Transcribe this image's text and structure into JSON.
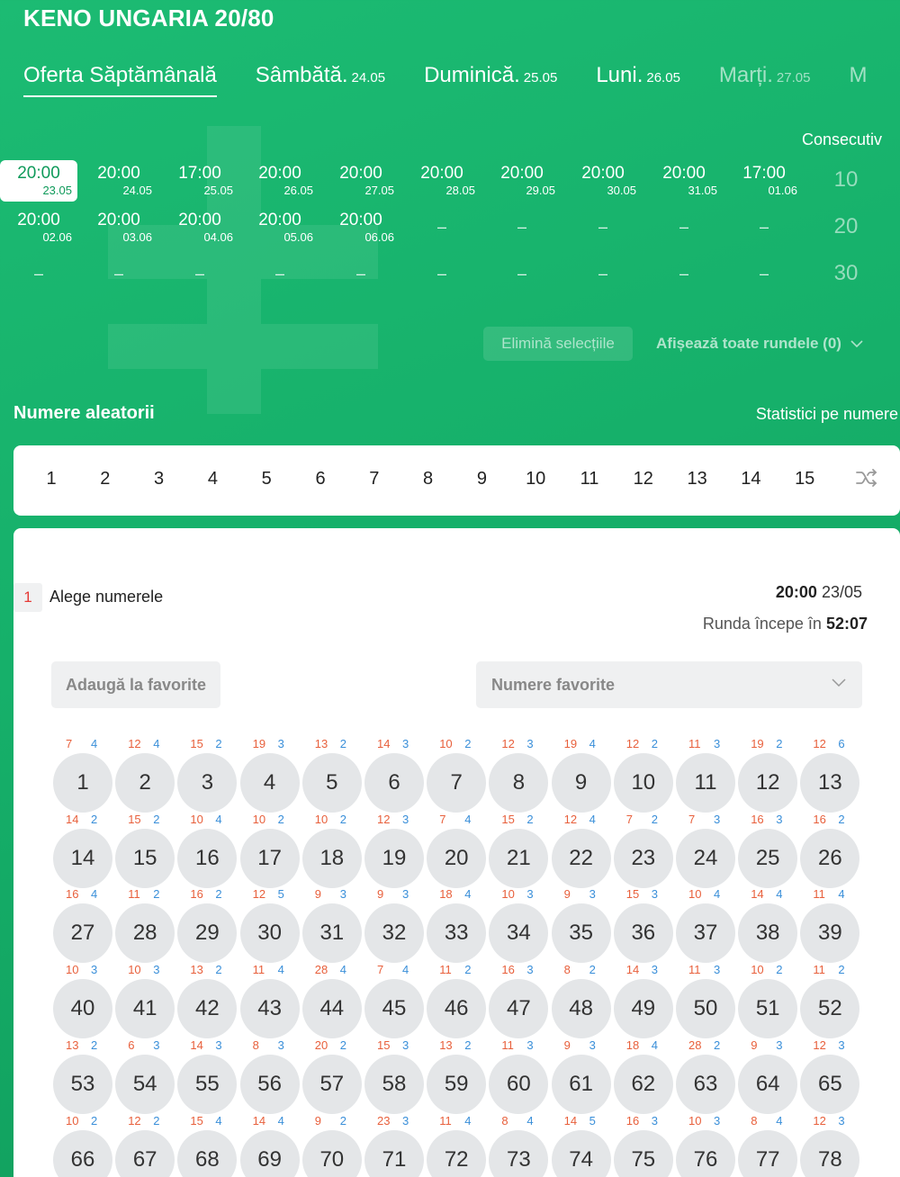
{
  "app": {
    "title": "KENO UNGARIA 20/80"
  },
  "tabs": [
    {
      "label": "Oferta Săptămânală",
      "date": ""
    },
    {
      "label": "Sâmbătă.",
      "date": "24.05"
    },
    {
      "label": "Duminică.",
      "date": "25.05"
    },
    {
      "label": "Luni.",
      "date": "26.05"
    },
    {
      "label": "Marți.",
      "date": "27.05"
    },
    {
      "label": "M",
      "date": ""
    }
  ],
  "consecutive": {
    "label": "Consecutiv",
    "values": [
      "10",
      "20",
      "30"
    ]
  },
  "slots": [
    [
      {
        "time": "20:00",
        "date": "23.05",
        "selected": true
      },
      {
        "time": "20:00",
        "date": "24.05"
      },
      {
        "time": "17:00",
        "date": "25.05"
      },
      {
        "time": "20:00",
        "date": "26.05"
      },
      {
        "time": "20:00",
        "date": "27.05"
      },
      {
        "time": "20:00",
        "date": "28.05"
      },
      {
        "time": "20:00",
        "date": "29.05"
      },
      {
        "time": "20:00",
        "date": "30.05"
      },
      {
        "time": "20:00",
        "date": "31.05"
      },
      {
        "time": "17:00",
        "date": "01.06"
      }
    ],
    [
      {
        "time": "20:00",
        "date": "02.06"
      },
      {
        "time": "20:00",
        "date": "03.06"
      },
      {
        "time": "20:00",
        "date": "04.06"
      },
      {
        "time": "20:00",
        "date": "05.06"
      },
      {
        "time": "20:00",
        "date": "06.06"
      },
      {
        "dash": "–"
      },
      {
        "dash": "–"
      },
      {
        "dash": "–"
      },
      {
        "dash": "–"
      },
      {
        "dash": "–"
      }
    ],
    [
      {
        "dash": "–"
      },
      {
        "dash": "–"
      },
      {
        "dash": "–"
      },
      {
        "dash": "–"
      },
      {
        "dash": "–"
      },
      {
        "dash": "–"
      },
      {
        "dash": "–"
      },
      {
        "dash": "–"
      },
      {
        "dash": "–"
      },
      {
        "dash": "–"
      }
    ]
  ],
  "actions": {
    "remove_selections": "Elimină selecțiile",
    "show_all_rounds": "Afișează toate rundele (0)"
  },
  "random_section": {
    "title": "Numere aleatorii",
    "stats_link": "Statistici pe numere",
    "numbers": [
      "1",
      "2",
      "3",
      "4",
      "5",
      "6",
      "7",
      "8",
      "9",
      "10",
      "11",
      "12",
      "13",
      "14",
      "15"
    ],
    "shuffle_icon": "shuffle-icon"
  },
  "pick": {
    "step": "1",
    "label": "Alege numerele",
    "round_time": "20:00",
    "round_date": "23/05",
    "starts_label": "Runda începe în",
    "countdown": "52:07",
    "add_favorites": "Adaugă la favorite",
    "favorites_placeholder": "Numere favorite"
  },
  "balls": [
    {
      "n": "1",
      "a": "7",
      "b": "4"
    },
    {
      "n": "2",
      "a": "12",
      "b": "4"
    },
    {
      "n": "3",
      "a": "15",
      "b": "2"
    },
    {
      "n": "4",
      "a": "19",
      "b": "3"
    },
    {
      "n": "5",
      "a": "13",
      "b": "2"
    },
    {
      "n": "6",
      "a": "14",
      "b": "3"
    },
    {
      "n": "7",
      "a": "10",
      "b": "2"
    },
    {
      "n": "8",
      "a": "12",
      "b": "3"
    },
    {
      "n": "9",
      "a": "19",
      "b": "4"
    },
    {
      "n": "10",
      "a": "12",
      "b": "2"
    },
    {
      "n": "11",
      "a": "11",
      "b": "3"
    },
    {
      "n": "12",
      "a": "19",
      "b": "2"
    },
    {
      "n": "13",
      "a": "12",
      "b": "6"
    },
    {
      "n": "14",
      "a": "14",
      "b": "2"
    },
    {
      "n": "15",
      "a": "15",
      "b": "2"
    },
    {
      "n": "16",
      "a": "10",
      "b": "4"
    },
    {
      "n": "17",
      "a": "10",
      "b": "2"
    },
    {
      "n": "18",
      "a": "10",
      "b": "2"
    },
    {
      "n": "19",
      "a": "12",
      "b": "3"
    },
    {
      "n": "20",
      "a": "7",
      "b": "4"
    },
    {
      "n": "21",
      "a": "15",
      "b": "2"
    },
    {
      "n": "22",
      "a": "12",
      "b": "4"
    },
    {
      "n": "23",
      "a": "7",
      "b": "2"
    },
    {
      "n": "24",
      "a": "7",
      "b": "3"
    },
    {
      "n": "25",
      "a": "16",
      "b": "3"
    },
    {
      "n": "26",
      "a": "16",
      "b": "2"
    },
    {
      "n": "27",
      "a": "16",
      "b": "4"
    },
    {
      "n": "28",
      "a": "11",
      "b": "2"
    },
    {
      "n": "29",
      "a": "16",
      "b": "2"
    },
    {
      "n": "30",
      "a": "12",
      "b": "5"
    },
    {
      "n": "31",
      "a": "9",
      "b": "3"
    },
    {
      "n": "32",
      "a": "9",
      "b": "3"
    },
    {
      "n": "33",
      "a": "18",
      "b": "4"
    },
    {
      "n": "34",
      "a": "10",
      "b": "3"
    },
    {
      "n": "35",
      "a": "9",
      "b": "3"
    },
    {
      "n": "36",
      "a": "15",
      "b": "3"
    },
    {
      "n": "37",
      "a": "10",
      "b": "4"
    },
    {
      "n": "38",
      "a": "14",
      "b": "4"
    },
    {
      "n": "39",
      "a": "11",
      "b": "4"
    },
    {
      "n": "40",
      "a": "10",
      "b": "3"
    },
    {
      "n": "41",
      "a": "10",
      "b": "3"
    },
    {
      "n": "42",
      "a": "13",
      "b": "2"
    },
    {
      "n": "43",
      "a": "11",
      "b": "4"
    },
    {
      "n": "44",
      "a": "28",
      "b": "4"
    },
    {
      "n": "45",
      "a": "7",
      "b": "4"
    },
    {
      "n": "46",
      "a": "11",
      "b": "2"
    },
    {
      "n": "47",
      "a": "16",
      "b": "3"
    },
    {
      "n": "48",
      "a": "8",
      "b": "2"
    },
    {
      "n": "49",
      "a": "14",
      "b": "3"
    },
    {
      "n": "50",
      "a": "11",
      "b": "3"
    },
    {
      "n": "51",
      "a": "10",
      "b": "2"
    },
    {
      "n": "52",
      "a": "11",
      "b": "2"
    },
    {
      "n": "53",
      "a": "13",
      "b": "2"
    },
    {
      "n": "54",
      "a": "6",
      "b": "3"
    },
    {
      "n": "55",
      "a": "14",
      "b": "3"
    },
    {
      "n": "56",
      "a": "8",
      "b": "3"
    },
    {
      "n": "57",
      "a": "20",
      "b": "2"
    },
    {
      "n": "58",
      "a": "15",
      "b": "3"
    },
    {
      "n": "59",
      "a": "13",
      "b": "2"
    },
    {
      "n": "60",
      "a": "11",
      "b": "3"
    },
    {
      "n": "61",
      "a": "9",
      "b": "3"
    },
    {
      "n": "62",
      "a": "18",
      "b": "4"
    },
    {
      "n": "63",
      "a": "28",
      "b": "2"
    },
    {
      "n": "64",
      "a": "9",
      "b": "3"
    },
    {
      "n": "65",
      "a": "12",
      "b": "3"
    },
    {
      "n": "66",
      "a": "10",
      "b": "2"
    },
    {
      "n": "67",
      "a": "12",
      "b": "2"
    },
    {
      "n": "68",
      "a": "15",
      "b": "4"
    },
    {
      "n": "69",
      "a": "14",
      "b": "4"
    },
    {
      "n": "70",
      "a": "9",
      "b": "2"
    },
    {
      "n": "71",
      "a": "23",
      "b": "3"
    },
    {
      "n": "72",
      "a": "11",
      "b": "4"
    },
    {
      "n": "73",
      "a": "8",
      "b": "4"
    },
    {
      "n": "74",
      "a": "14",
      "b": "5"
    },
    {
      "n": "75",
      "a": "16",
      "b": "3"
    },
    {
      "n": "76",
      "a": "10",
      "b": "3"
    },
    {
      "n": "77",
      "a": "8",
      "b": "4"
    },
    {
      "n": "78",
      "a": "12",
      "b": "3"
    }
  ]
}
